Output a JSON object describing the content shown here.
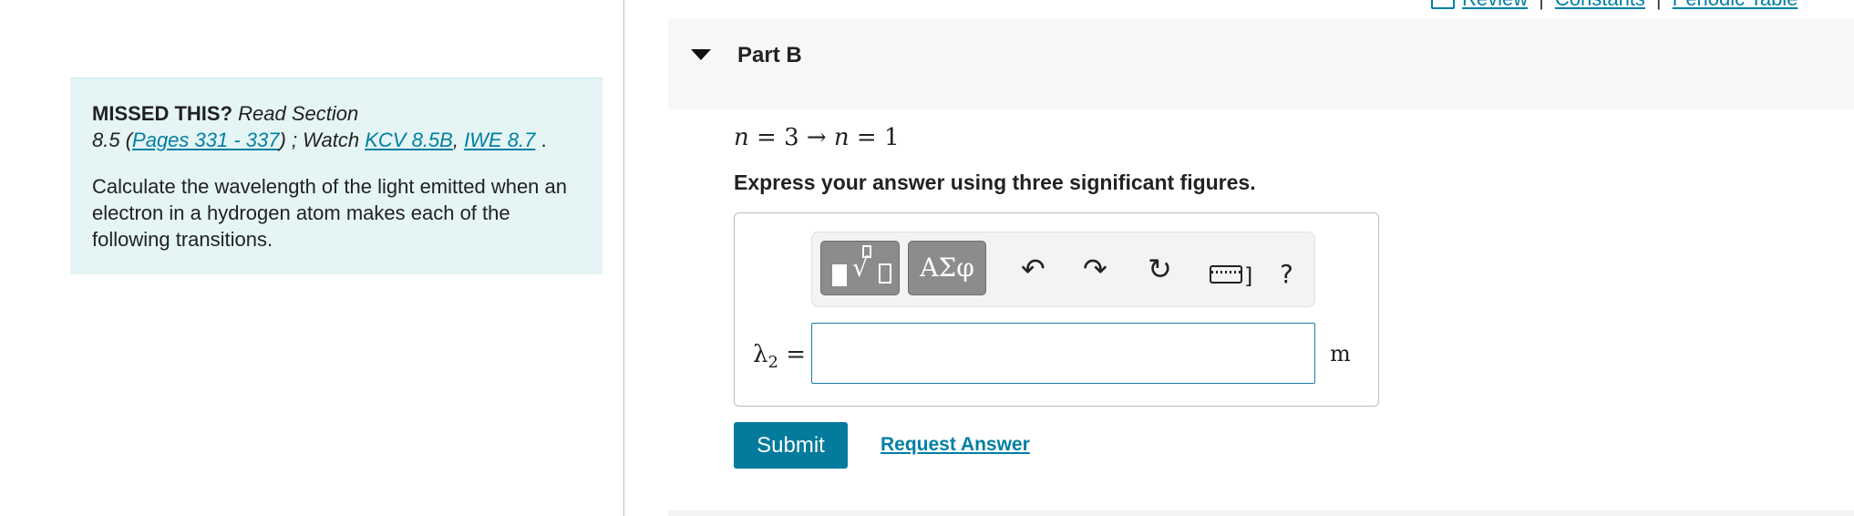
{
  "top_links": {
    "review": "Review",
    "constants": "Constants",
    "periodic_table": "Periodic Table",
    "separator": "|"
  },
  "missed": {
    "title": "MISSED THIS?",
    "read_section_prefix": "Read Section",
    "section_number": "8.5 (",
    "pages_link": "Pages 331 - 337",
    "after_pages": ") ; Watch ",
    "kcv_link": "KCV 8.5B",
    "comma": ", ",
    "iwe_link": "IWE 8.7",
    "end": " .",
    "question": "Calculate the wavelength of the light emitted when an electron in a hydrogen atom makes each of the following transitions."
  },
  "part": {
    "title": "Part B",
    "transition_n": "n",
    "transition_eq1": " = 3 → ",
    "transition_n2": "n",
    "transition_eq2": " = 1",
    "instruction": "Express your answer using three significant figures."
  },
  "toolbar": {
    "symbols_label": "ΑΣφ",
    "undo_glyph": "↶",
    "redo_glyph": "↷",
    "reset_glyph": "↻",
    "keyboard_bracket": "]",
    "help_label": "?",
    "icons": [
      "templates-icon",
      "symbols-icon",
      "undo-icon",
      "redo-icon",
      "reset-icon",
      "keyboard-icon",
      "help-icon"
    ]
  },
  "answer": {
    "lambda": "λ",
    "subscript": "2",
    "equals": " =",
    "value": "",
    "unit": "m"
  },
  "actions": {
    "submit": "Submit",
    "request_answer": "Request Answer"
  },
  "colors": {
    "link": "#007fa3",
    "submit_bg": "#047a9c",
    "missed_bg": "#e5f4f4",
    "part_header_bg": "#f7f7f7",
    "toolbar_btn": "#8c8c8c"
  }
}
